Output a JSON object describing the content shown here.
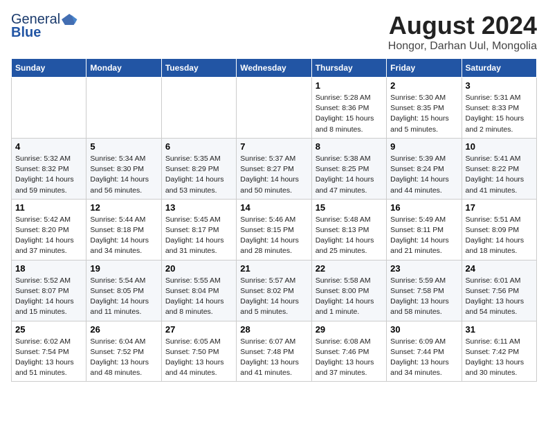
{
  "header": {
    "logo_general": "General",
    "logo_blue": "Blue",
    "month_year": "August 2024",
    "location": "Hongor, Darhan Uul, Mongolia"
  },
  "days_of_week": [
    "Sunday",
    "Monday",
    "Tuesday",
    "Wednesday",
    "Thursday",
    "Friday",
    "Saturday"
  ],
  "weeks": [
    [
      {
        "day": "",
        "info": ""
      },
      {
        "day": "",
        "info": ""
      },
      {
        "day": "",
        "info": ""
      },
      {
        "day": "",
        "info": ""
      },
      {
        "day": "1",
        "info": "Sunrise: 5:28 AM\nSunset: 8:36 PM\nDaylight: 15 hours\nand 8 minutes."
      },
      {
        "day": "2",
        "info": "Sunrise: 5:30 AM\nSunset: 8:35 PM\nDaylight: 15 hours\nand 5 minutes."
      },
      {
        "day": "3",
        "info": "Sunrise: 5:31 AM\nSunset: 8:33 PM\nDaylight: 15 hours\nand 2 minutes."
      }
    ],
    [
      {
        "day": "4",
        "info": "Sunrise: 5:32 AM\nSunset: 8:32 PM\nDaylight: 14 hours\nand 59 minutes."
      },
      {
        "day": "5",
        "info": "Sunrise: 5:34 AM\nSunset: 8:30 PM\nDaylight: 14 hours\nand 56 minutes."
      },
      {
        "day": "6",
        "info": "Sunrise: 5:35 AM\nSunset: 8:29 PM\nDaylight: 14 hours\nand 53 minutes."
      },
      {
        "day": "7",
        "info": "Sunrise: 5:37 AM\nSunset: 8:27 PM\nDaylight: 14 hours\nand 50 minutes."
      },
      {
        "day": "8",
        "info": "Sunrise: 5:38 AM\nSunset: 8:25 PM\nDaylight: 14 hours\nand 47 minutes."
      },
      {
        "day": "9",
        "info": "Sunrise: 5:39 AM\nSunset: 8:24 PM\nDaylight: 14 hours\nand 44 minutes."
      },
      {
        "day": "10",
        "info": "Sunrise: 5:41 AM\nSunset: 8:22 PM\nDaylight: 14 hours\nand 41 minutes."
      }
    ],
    [
      {
        "day": "11",
        "info": "Sunrise: 5:42 AM\nSunset: 8:20 PM\nDaylight: 14 hours\nand 37 minutes."
      },
      {
        "day": "12",
        "info": "Sunrise: 5:44 AM\nSunset: 8:18 PM\nDaylight: 14 hours\nand 34 minutes."
      },
      {
        "day": "13",
        "info": "Sunrise: 5:45 AM\nSunset: 8:17 PM\nDaylight: 14 hours\nand 31 minutes."
      },
      {
        "day": "14",
        "info": "Sunrise: 5:46 AM\nSunset: 8:15 PM\nDaylight: 14 hours\nand 28 minutes."
      },
      {
        "day": "15",
        "info": "Sunrise: 5:48 AM\nSunset: 8:13 PM\nDaylight: 14 hours\nand 25 minutes."
      },
      {
        "day": "16",
        "info": "Sunrise: 5:49 AM\nSunset: 8:11 PM\nDaylight: 14 hours\nand 21 minutes."
      },
      {
        "day": "17",
        "info": "Sunrise: 5:51 AM\nSunset: 8:09 PM\nDaylight: 14 hours\nand 18 minutes."
      }
    ],
    [
      {
        "day": "18",
        "info": "Sunrise: 5:52 AM\nSunset: 8:07 PM\nDaylight: 14 hours\nand 15 minutes."
      },
      {
        "day": "19",
        "info": "Sunrise: 5:54 AM\nSunset: 8:05 PM\nDaylight: 14 hours\nand 11 minutes."
      },
      {
        "day": "20",
        "info": "Sunrise: 5:55 AM\nSunset: 8:04 PM\nDaylight: 14 hours\nand 8 minutes."
      },
      {
        "day": "21",
        "info": "Sunrise: 5:57 AM\nSunset: 8:02 PM\nDaylight: 14 hours\nand 5 minutes."
      },
      {
        "day": "22",
        "info": "Sunrise: 5:58 AM\nSunset: 8:00 PM\nDaylight: 14 hours\nand 1 minute."
      },
      {
        "day": "23",
        "info": "Sunrise: 5:59 AM\nSunset: 7:58 PM\nDaylight: 13 hours\nand 58 minutes."
      },
      {
        "day": "24",
        "info": "Sunrise: 6:01 AM\nSunset: 7:56 PM\nDaylight: 13 hours\nand 54 minutes."
      }
    ],
    [
      {
        "day": "25",
        "info": "Sunrise: 6:02 AM\nSunset: 7:54 PM\nDaylight: 13 hours\nand 51 minutes."
      },
      {
        "day": "26",
        "info": "Sunrise: 6:04 AM\nSunset: 7:52 PM\nDaylight: 13 hours\nand 48 minutes."
      },
      {
        "day": "27",
        "info": "Sunrise: 6:05 AM\nSunset: 7:50 PM\nDaylight: 13 hours\nand 44 minutes."
      },
      {
        "day": "28",
        "info": "Sunrise: 6:07 AM\nSunset: 7:48 PM\nDaylight: 13 hours\nand 41 minutes."
      },
      {
        "day": "29",
        "info": "Sunrise: 6:08 AM\nSunset: 7:46 PM\nDaylight: 13 hours\nand 37 minutes."
      },
      {
        "day": "30",
        "info": "Sunrise: 6:09 AM\nSunset: 7:44 PM\nDaylight: 13 hours\nand 34 minutes."
      },
      {
        "day": "31",
        "info": "Sunrise: 6:11 AM\nSunset: 7:42 PM\nDaylight: 13 hours\nand 30 minutes."
      }
    ]
  ]
}
